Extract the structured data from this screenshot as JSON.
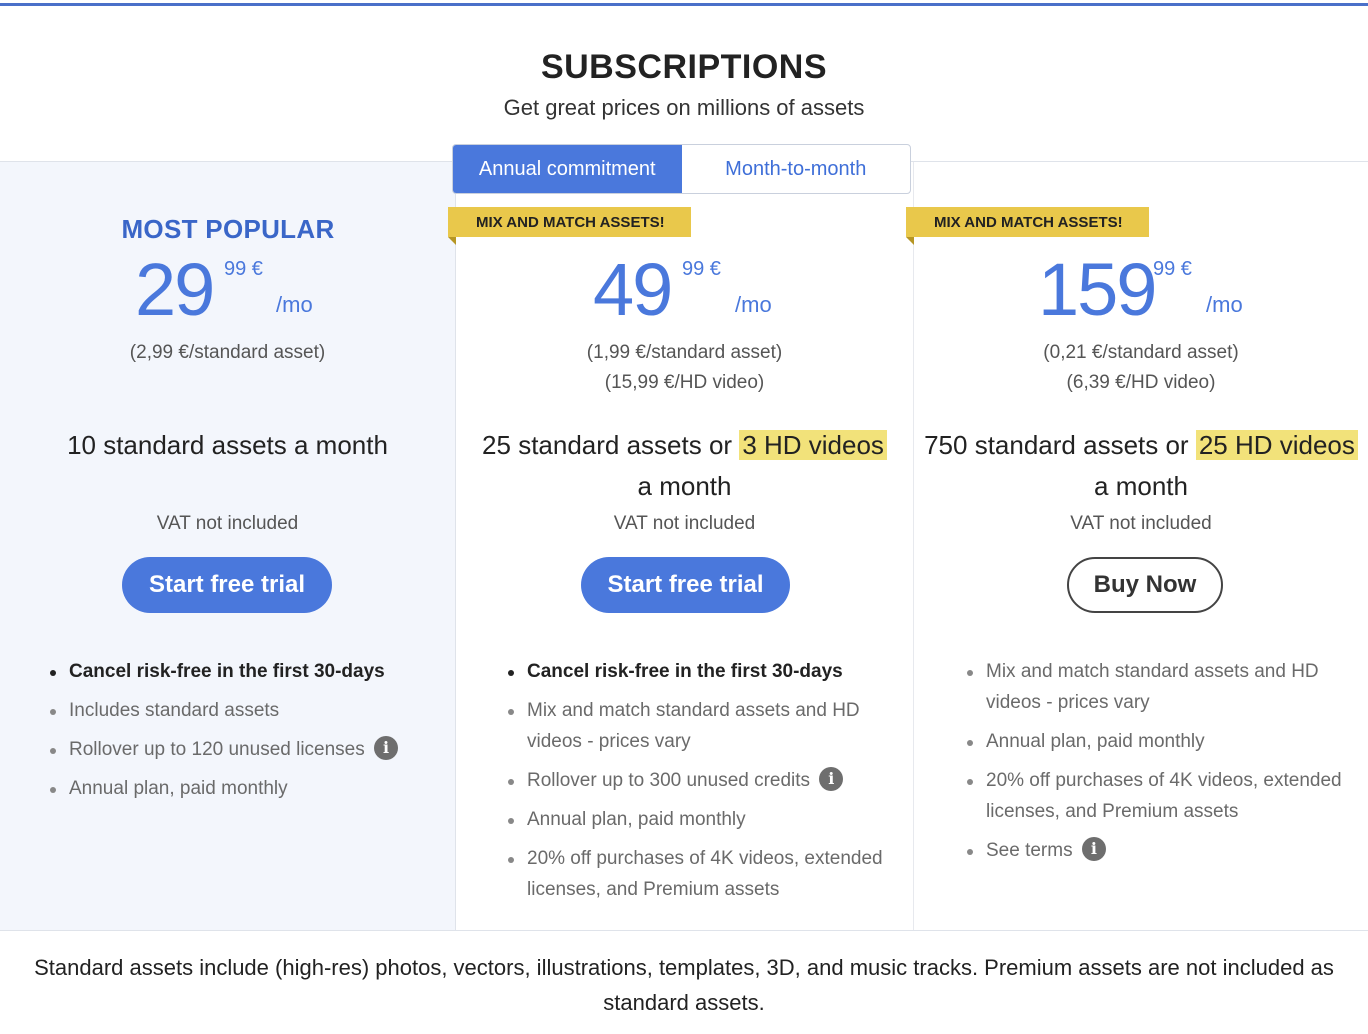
{
  "header": {
    "title": "SUBSCRIPTIONS",
    "subtitle": "Get great prices on millions of assets"
  },
  "toggle": {
    "options": [
      "Annual commitment",
      "Month-to-month"
    ],
    "selected": "Annual commitment"
  },
  "plans": [
    {
      "badge": "MOST POPULAR",
      "price_whole": "29",
      "price_cents": "99 €",
      "period": "/mo",
      "per_asset": [
        "(2,99 €/standard asset)"
      ],
      "offer": "10 standard assets a month",
      "vat": "VAT not included",
      "cta": "Start free trial",
      "features": [
        "Cancel risk-free in the first 30-days",
        "Includes standard assets",
        "Rollover up to 120 unused licenses",
        "Annual plan, paid monthly"
      ]
    },
    {
      "ribbon": "MIX AND MATCH ASSETS!",
      "price_whole": "49",
      "price_cents": "99 €",
      "period": "/mo",
      "per_asset": [
        "(1,99 €/standard asset)",
        "(15,99 €/HD video)"
      ],
      "offer_pre": "25 standard assets or ",
      "offer_hl": "3 HD videos",
      "offer_post": " a month",
      "vat": "VAT not included",
      "cta": "Start free trial",
      "features": [
        "Cancel risk-free in the first 30-days",
        "Mix and match standard assets and HD videos - prices vary",
        "Rollover up to 300 unused credits",
        "Annual plan, paid monthly",
        "20% off purchases of 4K videos, extended licenses, and Premium assets"
      ]
    },
    {
      "ribbon": "MIX AND MATCH ASSETS!",
      "price_whole": "159",
      "price_cents": "99 €",
      "period": "/mo",
      "per_asset": [
        "(0,21 €/standard asset)",
        "(6,39 €/HD video)"
      ],
      "offer_pre": "750 standard assets or ",
      "offer_hl": "25 HD videos",
      "offer_post": " a month",
      "vat": "VAT not included",
      "cta": "Buy Now",
      "features": [
        "Mix and match standard assets and HD videos - prices vary",
        "Annual plan, paid monthly",
        "20% off purchases of 4K videos, extended licenses, and Premium assets",
        "See terms"
      ]
    }
  ],
  "footer": {
    "note": "Standard assets include (high-res) photos, vectors, illustrations, templates, 3D, and music tracks. Premium assets are not included as standard assets."
  },
  "colors": {
    "accent": "#4a78dc",
    "highlight": "#f2e27a",
    "ribbon": "#e9c84b",
    "popular_bg": "#f3f6fc"
  },
  "icons": [
    "info-icon"
  ]
}
